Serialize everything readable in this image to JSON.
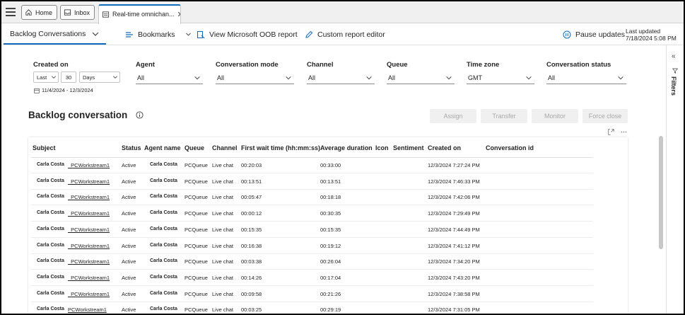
{
  "tabs": {
    "home_label": "Home",
    "inbox_label": "Inbox",
    "active_label": "Real-time omnichan..."
  },
  "command_bar": {
    "view_label": "Backlog Conversations",
    "bookmarks_label": "Bookmarks",
    "oob_label": "View Microsoft OOB report",
    "custom_label": "Custom report editor",
    "pause_label": "Pause updates",
    "last_updated_label": "Last updated",
    "last_updated_value": "7/18/2024 5:08 PM"
  },
  "filters": {
    "created_on": {
      "label": "Created on",
      "period": "Last",
      "count": "30",
      "unit": "Days",
      "range": "11/4/2024 - 12/3/2024"
    },
    "agent": {
      "label": "Agent",
      "value": "All"
    },
    "conversation_mode": {
      "label": "Conversation mode",
      "value": "All"
    },
    "channel": {
      "label": "Channel",
      "value": "All"
    },
    "queue": {
      "label": "Queue",
      "value": "All"
    },
    "time_zone": {
      "label": "Time zone",
      "value": "GMT"
    },
    "conversation_status": {
      "label": "Conversation status",
      "value": "All"
    }
  },
  "section": {
    "title": "Backlog conversation",
    "actions": {
      "assign": "Assign",
      "transfer": "Transfer",
      "monitor": "Monitor",
      "force_close": "Force close"
    }
  },
  "table": {
    "columns": {
      "subject": "Subject",
      "status": "Status",
      "agent": "Agent name",
      "queue": "Queue",
      "channel": "Channel",
      "first_wait": "First wait time (hh:mm:ss)",
      "avg_duration": "Average duration",
      "icon": "Icon",
      "sentiment": "Sentiment",
      "created_on": "Created on",
      "conversation_id": "Conversation id"
    },
    "rows": [
      {
        "subject_name": "Carla Costa",
        "subject_link": "_PCWorkstream1",
        "status": "Active",
        "agent": "Carla Costa",
        "queue": "PCQueue",
        "channel": "Live chat",
        "first_wait": "00:20:03",
        "avg_duration": "00:33:00",
        "created_on": "12/3/2024 7:27:24 PM"
      },
      {
        "subject_name": "Carla Costa",
        "subject_link": "_PCWorkstream1",
        "status": "Active",
        "agent": "Carla Costa",
        "queue": "PCQueue",
        "channel": "Live chat",
        "first_wait": "00:13:51",
        "avg_duration": "00:13:51",
        "created_on": "12/3/2024 7:46:33 PM"
      },
      {
        "subject_name": "Carla Costa",
        "subject_link": "_PCWorkstream1",
        "status": "Active",
        "agent": "Carla Costa",
        "queue": "PCQueue",
        "channel": "Live chat",
        "first_wait": "00:05:47",
        "avg_duration": "00:18:18",
        "created_on": "12/3/2024 7:42:06 PM"
      },
      {
        "subject_name": "Carla Costa",
        "subject_link": "_PCWorkstream1",
        "status": "Active",
        "agent": "Carla Costa",
        "queue": "PCQueue",
        "channel": "Live chat",
        "first_wait": "00:00:12",
        "avg_duration": "00:30:35",
        "created_on": "12/3/2024 7:29:49 PM"
      },
      {
        "subject_name": "Carla Costa",
        "subject_link": "_PCWorkstream1",
        "status": "Active",
        "agent": "Carla Costa",
        "queue": "PCQueue",
        "channel": "Live chat",
        "first_wait": "00:15:35",
        "avg_duration": "00:15:35",
        "created_on": "12/3/2024 7:44:49 PM"
      },
      {
        "subject_name": "Carla Costa",
        "subject_link": "_PCWorkstream1",
        "status": "Active",
        "agent": "Carla Costa",
        "queue": "PCQueue",
        "channel": "Live chat",
        "first_wait": "00:16:38",
        "avg_duration": "00:19:12",
        "created_on": "12/3/2024 7:41:12 PM"
      },
      {
        "subject_name": "Carla Costa",
        "subject_link": "_PCWorkstream1",
        "status": "Active",
        "agent": "Carla Costa",
        "queue": "PCQueue",
        "channel": "Live chat",
        "first_wait": "00:03:38",
        "avg_duration": "00:26:04",
        "created_on": "12/3/2024 7:34:20 PM"
      },
      {
        "subject_name": "Carla Costa",
        "subject_link": "_PCWorkstream1",
        "status": "Active",
        "agent": "Carla Costa",
        "queue": "PCQueue",
        "channel": "Live chat",
        "first_wait": "00:14:26",
        "avg_duration": "00:17:04",
        "created_on": "12/3/2024 7:43:20 PM"
      },
      {
        "subject_name": "Carla Costa",
        "subject_link": "_PCWorkstream1",
        "status": "Active",
        "agent": "Carla Costa",
        "queue": "PCQueue",
        "channel": "Live chat",
        "first_wait": "00:09:58",
        "avg_duration": "00:21:26",
        "created_on": "12/3/2024 7:38:58 PM"
      },
      {
        "subject_name": "Carla Costa",
        "subject_link": "PCWorkstream1",
        "status": "Active",
        "agent": "Carla Costa",
        "queue": "PCQueue",
        "channel": "Live chat",
        "first_wait": "00:03:25",
        "avg_duration": "00:29:19",
        "created_on": "12/3/2024 7:31:05 PM"
      }
    ]
  },
  "side_pane": {
    "label": "Filters"
  },
  "colors": {
    "accent": "#0f6cbd",
    "disabled_text": "#a8a8a8",
    "disabled_bg": "#f0f0f0"
  }
}
